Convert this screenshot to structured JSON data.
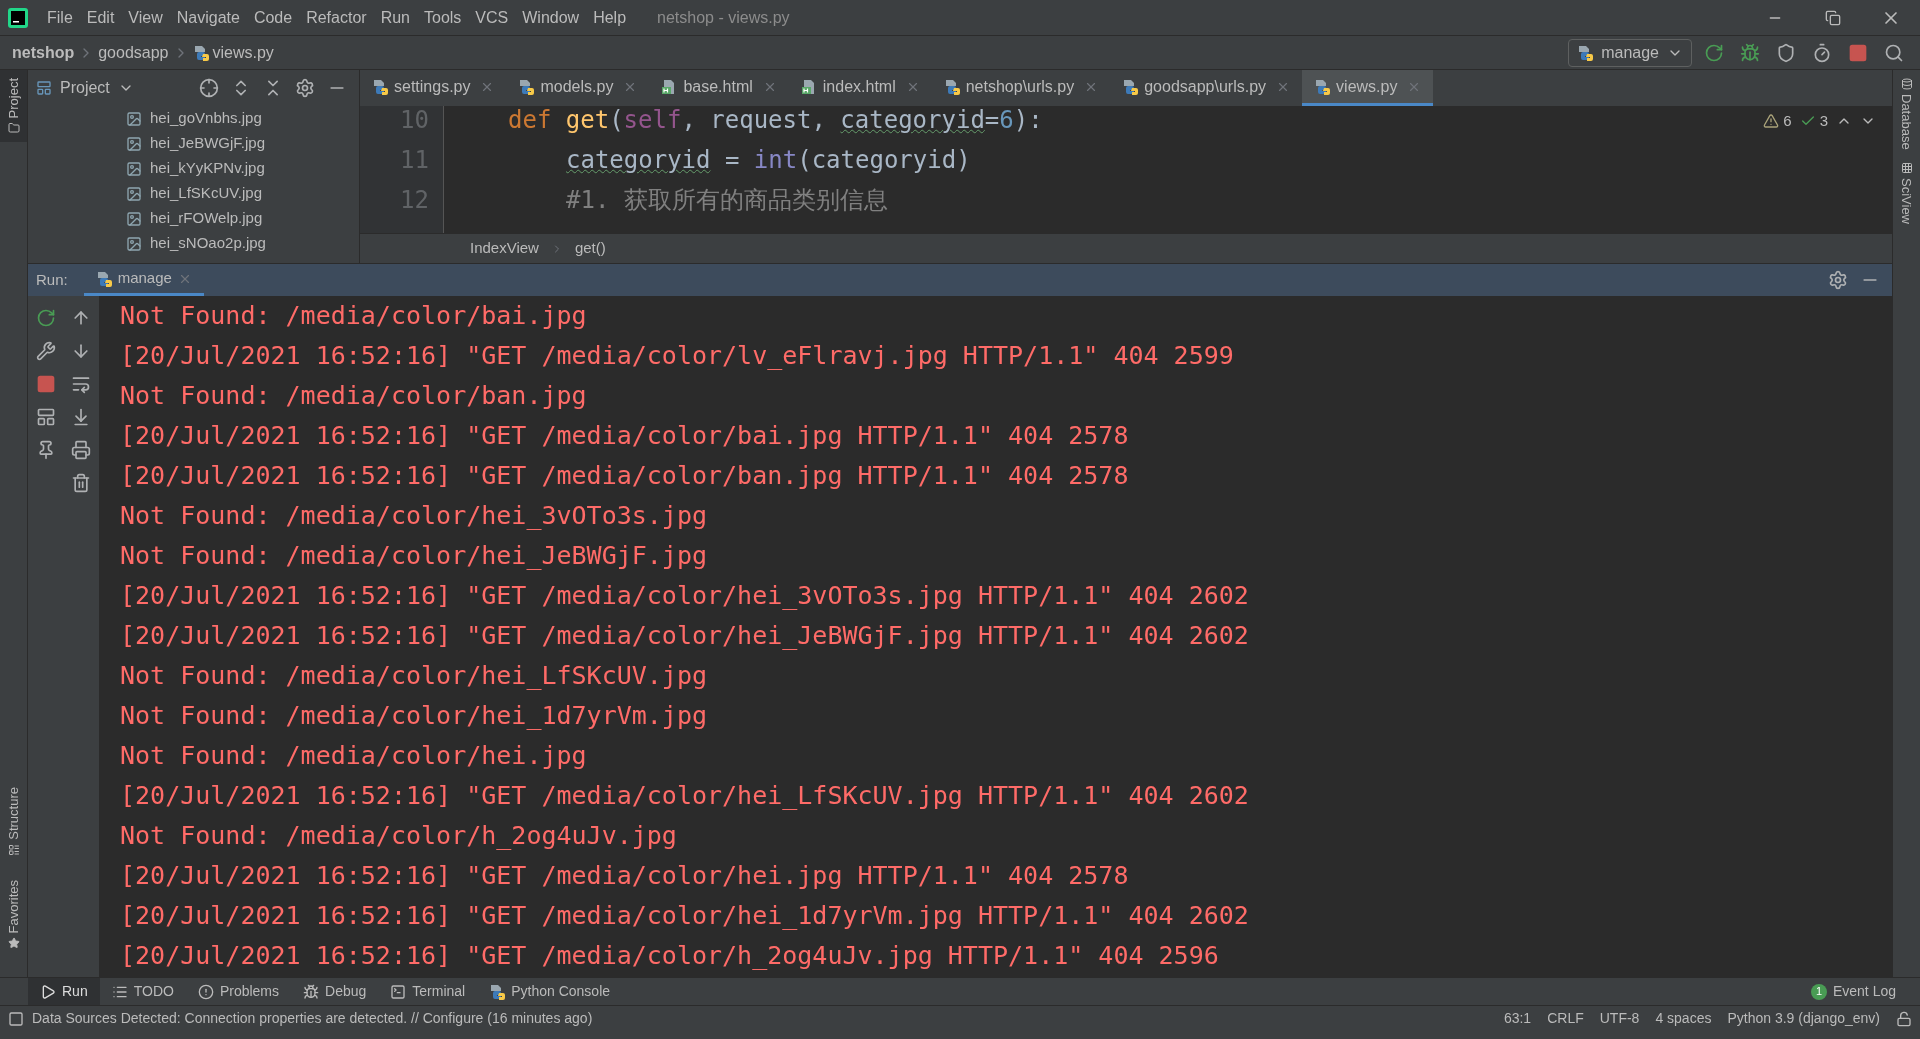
{
  "menu": [
    "File",
    "Edit",
    "View",
    "Navigate",
    "Code",
    "Refactor",
    "Run",
    "Tools",
    "VCS",
    "Window",
    "Help"
  ],
  "window": {
    "title": "netshop - views.py"
  },
  "breadcrumbs": [
    {
      "label": "netshop",
      "bold": true
    },
    {
      "label": "goodsapp",
      "bold": false
    },
    {
      "label": "views.py",
      "bold": false
    }
  ],
  "run_config": "manage",
  "left_stripe": {
    "top": [
      "Project"
    ],
    "bottom": [
      "Structure",
      "Favorites"
    ]
  },
  "right_stripe": [
    "Database",
    "SciView"
  ],
  "project_panel": {
    "title": "Project",
    "files": [
      "hei_goVnbhs.jpg",
      "hei_JeBWGjF.jpg",
      "hei_kYyKPNv.jpg",
      "hei_LfSKcUV.jpg",
      "hei_rFOWelp.jpg",
      "hei_sNOao2p.jpg"
    ]
  },
  "tabs": [
    {
      "label": "settings.py",
      "kind": "python",
      "selected": false
    },
    {
      "label": "models.py",
      "kind": "python",
      "selected": false
    },
    {
      "label": "base.html",
      "kind": "html",
      "selected": false
    },
    {
      "label": "index.html",
      "kind": "html",
      "selected": false
    },
    {
      "label": "netshop\\urls.py",
      "kind": "python",
      "selected": false
    },
    {
      "label": "goodsapp\\urls.py",
      "kind": "python",
      "selected": false
    },
    {
      "label": "views.py",
      "kind": "python",
      "selected": true
    }
  ],
  "editor": {
    "inspections": {
      "warnings": "6",
      "weak_warnings": "3"
    },
    "lines": [
      {
        "number": "10",
        "tokens": [
          {
            "text": "def ",
            "kind": "keyword"
          },
          {
            "text": "get",
            "kind": "function"
          },
          {
            "text": "(",
            "kind": "plain"
          },
          {
            "text": "self",
            "kind": "self"
          },
          {
            "text": ", request, ",
            "kind": "plain"
          },
          {
            "text": "categoryid",
            "kind": "typo"
          },
          {
            "text": "=",
            "kind": "plain"
          },
          {
            "text": "6",
            "kind": "number"
          },
          {
            "text": "):",
            "kind": "plain"
          }
        ],
        "children": [
          {
            "number": "11",
            "tokens": [
              {
                "text": "categoryid",
                "kind": "typo"
              },
              {
                "text": " = ",
                "kind": "plain"
              },
              {
                "text": "int",
                "kind": "builtin"
              },
              {
                "text": "(categoryid)",
                "kind": "plain"
              }
            ]
          },
          {
            "number": "12",
            "tokens": [
              {
                "text": "#1. 获取所有的商品类别信息",
                "kind": "comment"
              }
            ]
          }
        ]
      }
    ],
    "breadcrumbs": [
      "IndexView",
      "get()"
    ]
  },
  "run": {
    "label": "Run:",
    "tab": "manage",
    "output": [
      "Not Found: /media/color/bai.jpg",
      "[20/Jul/2021 16:52:16] \"GET /media/color/lv_eFlravj.jpg HTTP/1.1\" 404 2599",
      "Not Found: /media/color/ban.jpg",
      "[20/Jul/2021 16:52:16] \"GET /media/color/bai.jpg HTTP/1.1\" 404 2578",
      "[20/Jul/2021 16:52:16] \"GET /media/color/ban.jpg HTTP/1.1\" 404 2578",
      "Not Found: /media/color/hei_3vOTo3s.jpg",
      "Not Found: /media/color/hei_JeBWGjF.jpg",
      "[20/Jul/2021 16:52:16] \"GET /media/color/hei_3vOTo3s.jpg HTTP/1.1\" 404 2602",
      "[20/Jul/2021 16:52:16] \"GET /media/color/hei_JeBWGjF.jpg HTTP/1.1\" 404 2602",
      "Not Found: /media/color/hei_LfSKcUV.jpg",
      "Not Found: /media/color/hei_1d7yrVm.jpg",
      "Not Found: /media/color/hei.jpg",
      "[20/Jul/2021 16:52:16] \"GET /media/color/hei_LfSKcUV.jpg HTTP/1.1\" 404 2602",
      "Not Found: /media/color/h_2og4uJv.jpg",
      "[20/Jul/2021 16:52:16] \"GET /media/color/hei.jpg HTTP/1.1\" 404 2578",
      "[20/Jul/2021 16:52:16] \"GET /media/color/hei_1d7yrVm.jpg HTTP/1.1\" 404 2602",
      "[20/Jul/2021 16:52:16] \"GET /media/color/h_2og4uJv.jpg HTTP/1.1\" 404 2596"
    ]
  },
  "tool_tabs": [
    {
      "label": "Run",
      "kind": "run",
      "selected": true
    },
    {
      "label": "TODO",
      "kind": "todo",
      "selected": false
    },
    {
      "label": "Problems",
      "kind": "problems",
      "selected": false
    },
    {
      "label": "Debug",
      "kind": "debug",
      "selected": false
    },
    {
      "label": "Terminal",
      "kind": "terminal",
      "selected": false
    },
    {
      "label": "Python Console",
      "kind": "console",
      "selected": false
    }
  ],
  "event_log": {
    "label": "Event Log",
    "count": "1"
  },
  "status_bar": {
    "message": "Data Sources Detected: Connection properties are detected. // Configure (16 minutes ago)",
    "items": [
      "63:1",
      "CRLF",
      "UTF-8",
      "4 spaces",
      "Python 3.9 (django_env)"
    ]
  }
}
